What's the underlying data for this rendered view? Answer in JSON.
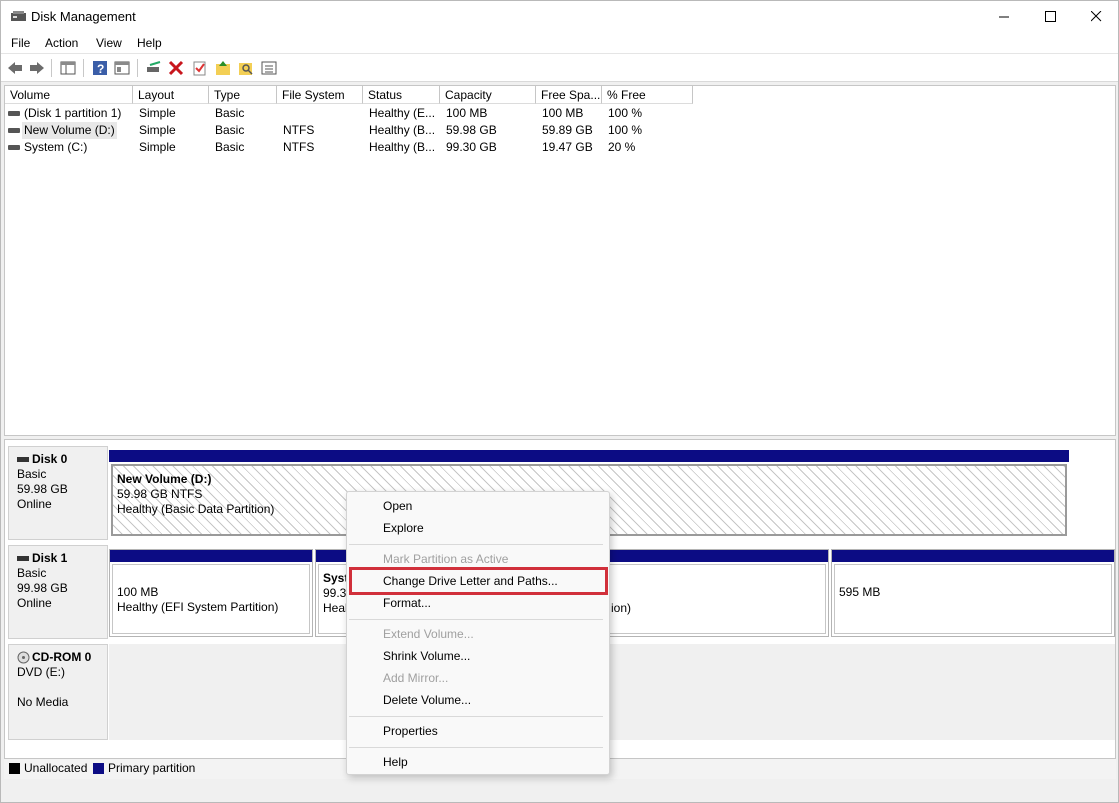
{
  "window": {
    "title": "Disk Management"
  },
  "menu": [
    "File",
    "Action",
    "View",
    "Help"
  ],
  "toolbar": {
    "icons": [
      "back-icon",
      "forward-icon",
      "show-hide-console-tree-icon",
      "help-icon",
      "properties-view-icon",
      "rescan-icon",
      "delete-icon",
      "check-icon",
      "up-folder-icon",
      "search-folder-icon",
      "list-icon"
    ]
  },
  "list": {
    "headers": [
      "Volume",
      "Layout",
      "Type",
      "File System",
      "Status",
      "Capacity",
      "Free Spa...",
      "% Free"
    ],
    "rows": [
      {
        "volume": "(Disk 1 partition 1)",
        "layout": "Simple",
        "type": "Basic",
        "fs": "",
        "status": "Healthy (E...",
        "capacity": "100 MB",
        "free": "100 MB",
        "pct": "100 %"
      },
      {
        "volume": "New Volume (D:)",
        "layout": "Simple",
        "type": "Basic",
        "fs": "NTFS",
        "status": "Healthy (B...",
        "capacity": "59.98 GB",
        "free": "59.89 GB",
        "pct": "100 %"
      },
      {
        "volume": "System (C:)",
        "layout": "Simple",
        "type": "Basic",
        "fs": "NTFS",
        "status": "Healthy (B...",
        "capacity": "99.30 GB",
        "free": "19.47 GB",
        "pct": "20 %"
      }
    ]
  },
  "disks": {
    "disk0": {
      "name": "Disk 0",
      "type": "Basic",
      "size": "59.98 GB",
      "state": "Online",
      "partition": {
        "name": "New Volume  (D:)",
        "size": "59.98 GB NTFS",
        "status": "Healthy (Basic Data Partition)"
      }
    },
    "disk1": {
      "name": "Disk 1",
      "type": "Basic",
      "size": "99.98 GB",
      "state": "Online",
      "p1": {
        "size": "100 MB",
        "status": "Healthy (EFI System Partition)"
      },
      "p2": {
        "name": "Syst",
        "size": "99.30",
        "status": "Heal"
      },
      "p2_tail": "ion)",
      "p3": {
        "size": "595 MB"
      }
    },
    "cdrom": {
      "name": "CD-ROM 0",
      "type": "DVD (E:)",
      "state": "No Media"
    }
  },
  "legend": {
    "unallocated": "Unallocated",
    "primary": "Primary partition",
    "unallocated_color": "#000000",
    "primary_color": "#0c0c84"
  },
  "context_menu": {
    "items": [
      {
        "label": "Open",
        "enabled": true
      },
      {
        "label": "Explore",
        "enabled": true
      },
      {
        "label": "Mark Partition as Active",
        "enabled": false
      },
      {
        "label": "Change Drive Letter and Paths...",
        "enabled": true,
        "highlighted": true
      },
      {
        "label": "Format...",
        "enabled": true
      },
      {
        "label": "Extend Volume...",
        "enabled": false
      },
      {
        "label": "Shrink Volume...",
        "enabled": true
      },
      {
        "label": "Add Mirror...",
        "enabled": false
      },
      {
        "label": "Delete Volume...",
        "enabled": true
      },
      {
        "label": "Properties",
        "enabled": true
      },
      {
        "label": "Help",
        "enabled": true
      }
    ],
    "highlight_color": "#d1303b"
  }
}
